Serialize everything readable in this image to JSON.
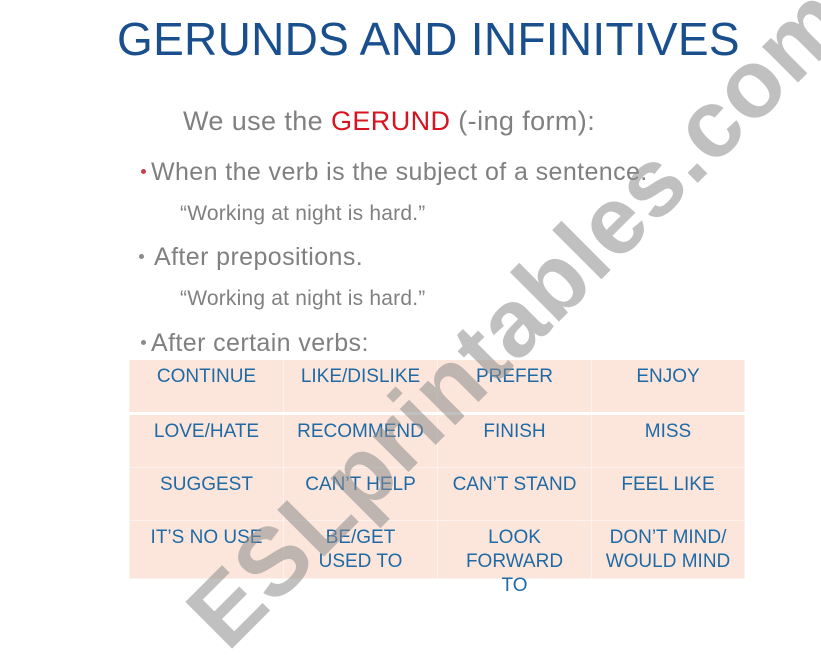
{
  "slide": {
    "title": "GERUNDS AND INFINITIVES",
    "heading": {
      "prefix": "We use the ",
      "accent": "GERUND",
      "suffix": " (-ing form):"
    },
    "colors": {
      "title": "#1a4f8e",
      "accent": "#d7141f",
      "body_text": "#808080",
      "table_bg": "#fce6dc",
      "table_text": "#1f6aa5",
      "first_bullet": "#c0444e"
    },
    "points": [
      {
        "bullet": "When the verb is the subject of a sentence.",
        "example": "“Working at night is hard.”"
      },
      {
        "bullet": "After prepositions.",
        "example": "“Working at night is hard.”"
      },
      {
        "bullet": "After certain verbs:"
      }
    ],
    "verbs_table": {
      "rows": [
        [
          "CONTINUE",
          "LIKE/DISLIKE",
          "PREFER",
          "ENJOY"
        ],
        [
          "LOVE/HATE",
          "RECOMMEND",
          "FINISH",
          "MISS"
        ],
        [
          "SUGGEST",
          "CAN’T HELP",
          "CAN’T STAND",
          "FEEL LIKE"
        ],
        [
          "IT’S  NO USE",
          "BE/GET\nUSED TO",
          "LOOK\nFORWARD\nTO",
          "DON’T MIND/\nWOULD MIND"
        ]
      ]
    }
  },
  "watermark": {
    "text": "ESLprintables.com"
  }
}
